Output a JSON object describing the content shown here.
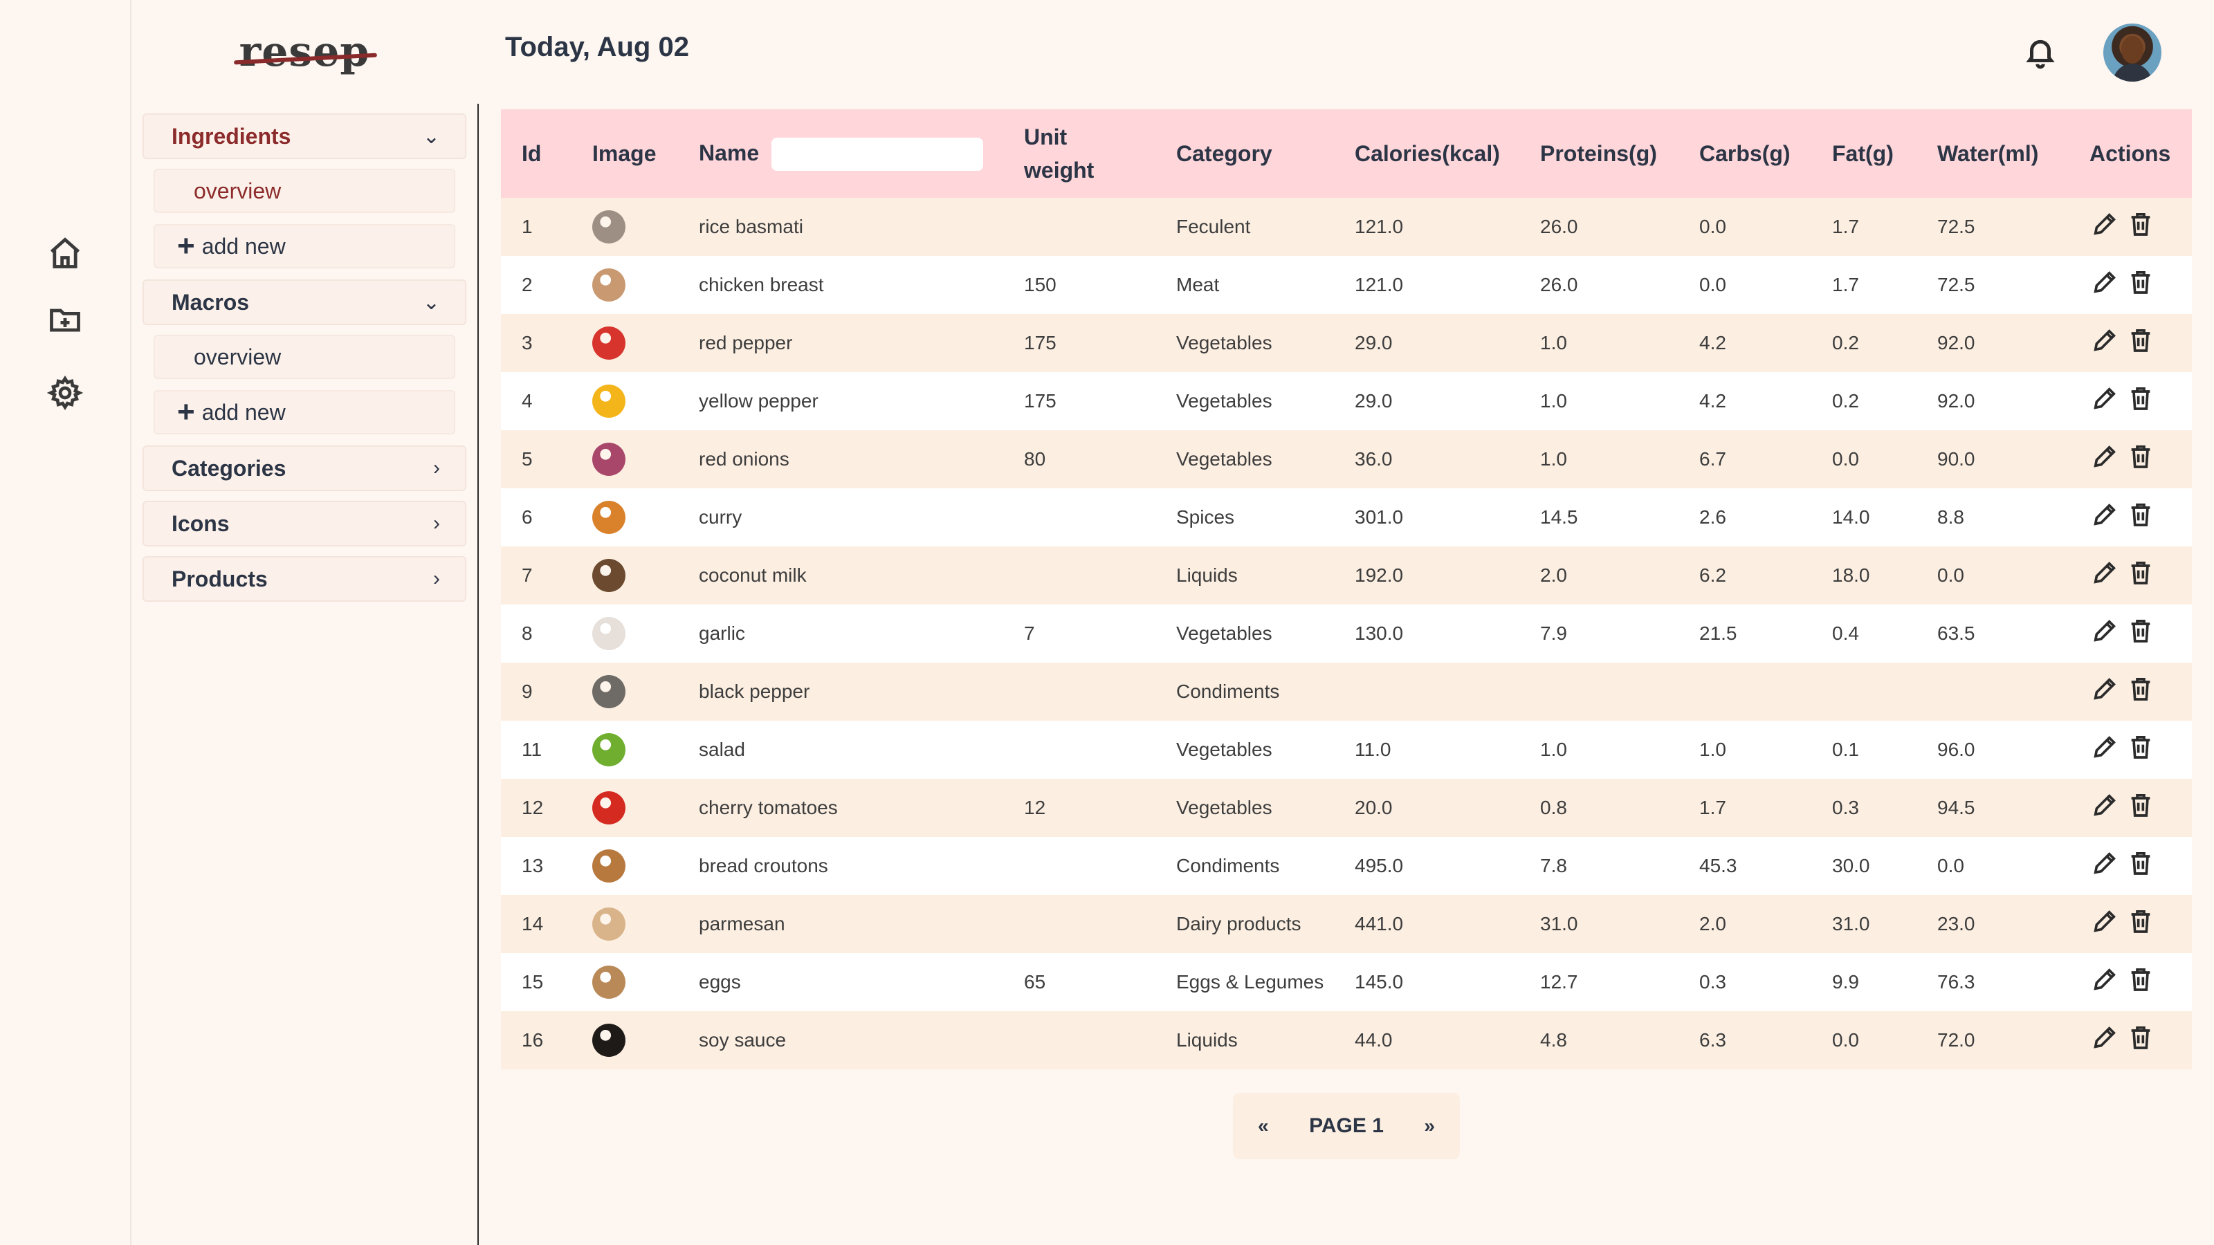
{
  "app": {
    "logo": "resep"
  },
  "header": {
    "title": "Today, Aug 02"
  },
  "rail": [
    "home-icon",
    "folder-plus-icon",
    "gear-icon"
  ],
  "sidebar": {
    "ingredients": {
      "label": "Ingredients",
      "overview": "overview",
      "add_new": "add new",
      "plus": "+"
    },
    "macros": {
      "label": "Macros",
      "overview": "overview",
      "add_new": "add new",
      "plus": "+"
    },
    "categories": {
      "label": "Categories"
    },
    "icons": {
      "label": "Icons"
    },
    "products": {
      "label": "Products"
    }
  },
  "table": {
    "columns": {
      "id": "Id",
      "image": "Image",
      "name": "Name",
      "unit_weight_1": "Unit",
      "unit_weight_2": "weight",
      "category": "Category",
      "calories": "Calories(kcal)",
      "proteins": "Proteins(g)",
      "carbs": "Carbs(g)",
      "fat": "Fat(g)",
      "water": "Water(ml)",
      "actions": "Actions"
    },
    "rows": [
      {
        "id": "1",
        "color": "#9e8f84",
        "name": "rice basmati",
        "unit": "",
        "category": "Feculent",
        "cal": "121.0",
        "pro": "26.0",
        "carb": "0.0",
        "fat": "1.7",
        "water": "72.5"
      },
      {
        "id": "2",
        "color": "#c99a72",
        "name": "chicken breast",
        "unit": "150",
        "category": "Meat",
        "cal": "121.0",
        "pro": "26.0",
        "carb": "0.0",
        "fat": "1.7",
        "water": "72.5"
      },
      {
        "id": "3",
        "color": "#d6342c",
        "name": "red pepper",
        "unit": "175",
        "category": "Vegetables",
        "cal": "29.0",
        "pro": "1.0",
        "carb": "4.2",
        "fat": "0.2",
        "water": "92.0"
      },
      {
        "id": "4",
        "color": "#f3b51a",
        "name": "yellow pepper",
        "unit": "175",
        "category": "Vegetables",
        "cal": "29.0",
        "pro": "1.0",
        "carb": "4.2",
        "fat": "0.2",
        "water": "92.0"
      },
      {
        "id": "5",
        "color": "#a8476a",
        "name": "red onions",
        "unit": "80",
        "category": "Vegetables",
        "cal": "36.0",
        "pro": "1.0",
        "carb": "6.7",
        "fat": "0.0",
        "water": "90.0"
      },
      {
        "id": "6",
        "color": "#d9822b",
        "name": "curry",
        "unit": "",
        "category": "Spices",
        "cal": "301.0",
        "pro": "14.5",
        "carb": "2.6",
        "fat": "14.0",
        "water": "8.8"
      },
      {
        "id": "7",
        "color": "#6b4a30",
        "name": "coconut milk",
        "unit": "",
        "category": "Liquids",
        "cal": "192.0",
        "pro": "2.0",
        "carb": "6.2",
        "fat": "18.0",
        "water": "0.0"
      },
      {
        "id": "8",
        "color": "#e6dfda",
        "name": "garlic",
        "unit": "7",
        "category": "Vegetables",
        "cal": "130.0",
        "pro": "7.9",
        "carb": "21.5",
        "fat": "0.4",
        "water": "63.5"
      },
      {
        "id": "9",
        "color": "#6e6a66",
        "name": "black pepper",
        "unit": "",
        "category": "Condiments",
        "cal": "",
        "pro": "",
        "carb": "",
        "fat": "",
        "water": ""
      },
      {
        "id": "11",
        "color": "#6fae2f",
        "name": "salad",
        "unit": "",
        "category": "Vegetables",
        "cal": "11.0",
        "pro": "1.0",
        "carb": "1.0",
        "fat": "0.1",
        "water": "96.0"
      },
      {
        "id": "12",
        "color": "#d42a20",
        "name": "cherry tomatoes",
        "unit": "12",
        "category": "Vegetables",
        "cal": "20.0",
        "pro": "0.8",
        "carb": "1.7",
        "fat": "0.3",
        "water": "94.5"
      },
      {
        "id": "13",
        "color": "#b8793f",
        "name": "bread croutons",
        "unit": "",
        "category": "Condiments",
        "cal": "495.0",
        "pro": "7.8",
        "carb": "45.3",
        "fat": "30.0",
        "water": "0.0"
      },
      {
        "id": "14",
        "color": "#d9b48a",
        "name": "parmesan",
        "unit": "",
        "category": "Dairy products",
        "cal": "441.0",
        "pro": "31.0",
        "carb": "2.0",
        "fat": "31.0",
        "water": "23.0"
      },
      {
        "id": "15",
        "color": "#b98957",
        "name": "eggs",
        "unit": "65",
        "category": "Eggs & Legumes",
        "cal": "145.0",
        "pro": "12.7",
        "carb": "0.3",
        "fat": "9.9",
        "water": "76.3"
      },
      {
        "id": "16",
        "color": "#1e1a18",
        "name": "soy sauce",
        "unit": "",
        "category": "Liquids",
        "cal": "44.0",
        "pro": "4.8",
        "carb": "6.3",
        "fat": "0.0",
        "water": "72.0"
      }
    ]
  },
  "pagination": {
    "prev": "«",
    "label": "PAGE 1",
    "next": "»"
  }
}
